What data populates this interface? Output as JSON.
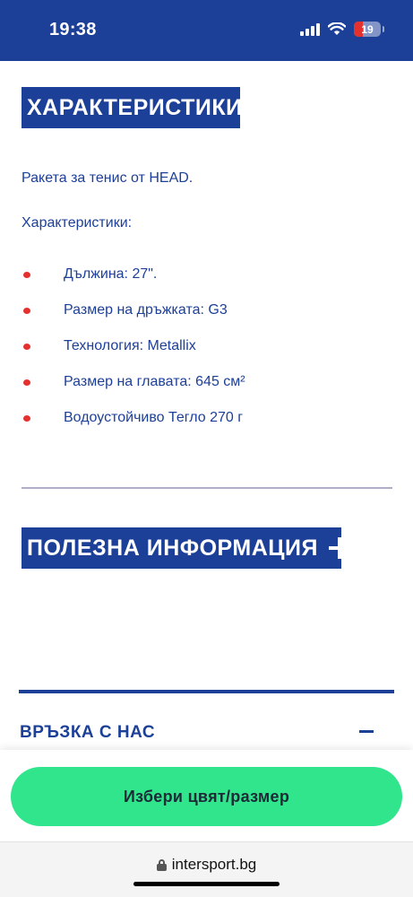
{
  "status_bar": {
    "time": "19:38",
    "battery_level": "19",
    "icons": [
      "signal-icon",
      "wifi-icon",
      "battery-icon"
    ]
  },
  "specs": {
    "heading": "ХАРАКТЕРИСТИКИ",
    "intro": "Ракета за тенис от HEAD.",
    "subheading": "Характеристики:",
    "items": [
      "Дължина: 27\".",
      "Размер на дръжката: G3",
      "Технология: Metallix",
      "Размер на главата: 645 см²",
      "Водоустойчиво Тегло 270 г"
    ]
  },
  "useful_info": {
    "heading": "ПОЛЕЗНА ИНФОРМАЦИЯ"
  },
  "contact": {
    "heading": "ВРЪЗКА С НАС"
  },
  "cta": {
    "label": "Избери цвят/размер"
  },
  "browser": {
    "url": "intersport.bg"
  },
  "colors": {
    "brand_blue": "#1c3f98",
    "cta_green": "#30e58c",
    "bullet_red": "#e3312e"
  }
}
